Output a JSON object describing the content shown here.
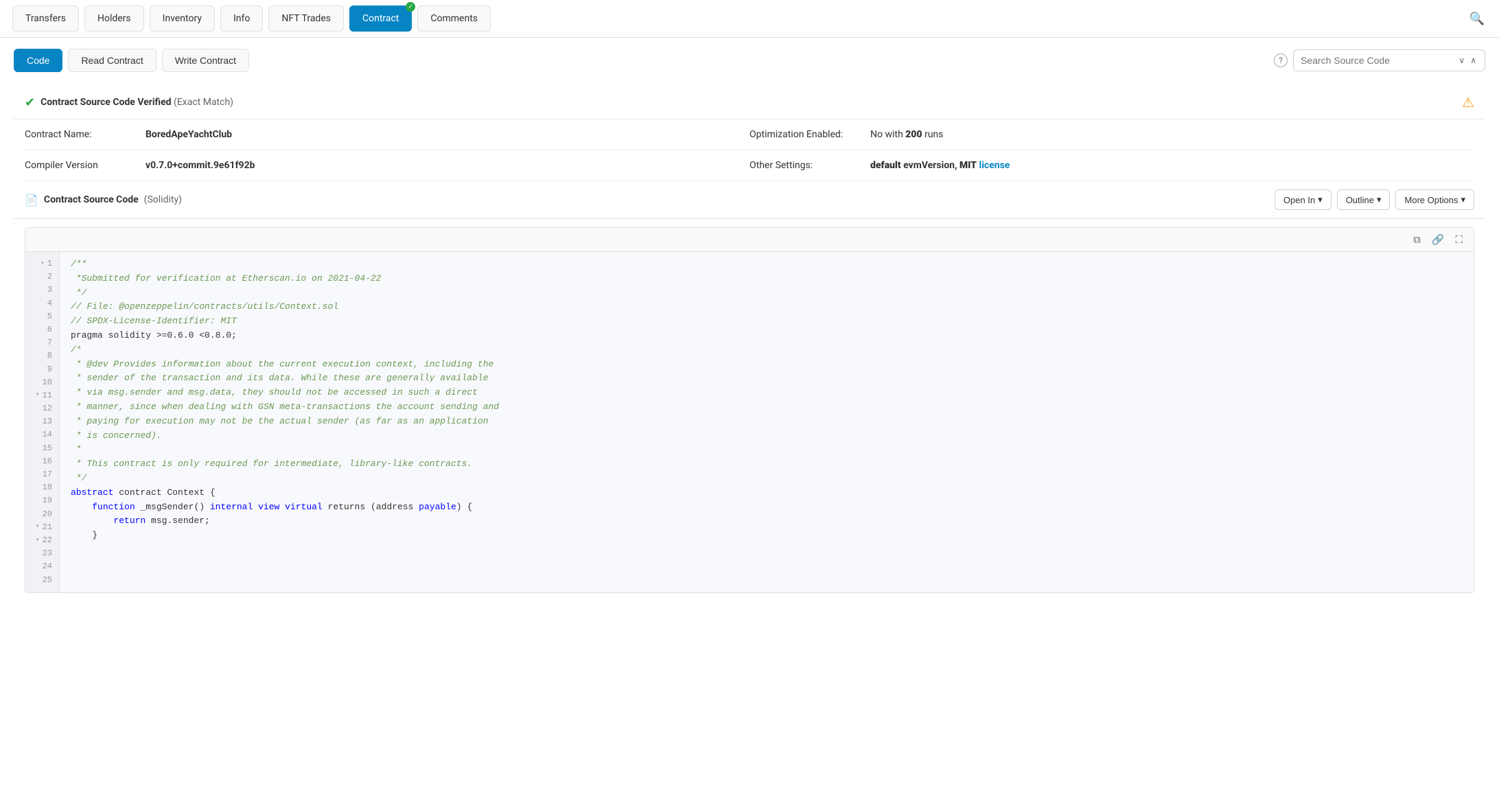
{
  "nav": {
    "tabs": [
      {
        "id": "transfers",
        "label": "Transfers",
        "active": false
      },
      {
        "id": "holders",
        "label": "Holders",
        "active": false
      },
      {
        "id": "inventory",
        "label": "Inventory",
        "active": false
      },
      {
        "id": "info",
        "label": "Info",
        "active": false
      },
      {
        "id": "nft-trades",
        "label": "NFT Trades",
        "active": false
      },
      {
        "id": "contract",
        "label": "Contract",
        "active": true,
        "verified": true
      },
      {
        "id": "comments",
        "label": "Comments",
        "active": false
      }
    ],
    "search_icon": "🔍"
  },
  "sub_tabs": {
    "items": [
      {
        "id": "code",
        "label": "Code",
        "active": true
      },
      {
        "id": "read-contract",
        "label": "Read Contract",
        "active": false
      },
      {
        "id": "write-contract",
        "label": "Write Contract",
        "active": false
      }
    ]
  },
  "search_source": {
    "placeholder": "Search Source Code",
    "help_label": "?",
    "chevron_down": "⌄",
    "chevron_up": "⌃"
  },
  "verified": {
    "check_icon": "✔",
    "title": "Contract Source Code Verified",
    "subtitle": "(Exact Match)",
    "warning_icon": "⚠"
  },
  "contract_info": {
    "name_label": "Contract Name:",
    "name_value": "BoredApeYachtClub",
    "optimization_label": "Optimization Enabled:",
    "optimization_value": "No with ",
    "optimization_runs": "200",
    "optimization_suffix": " runs",
    "compiler_label": "Compiler Version",
    "compiler_value": "v0.7.0+commit.9e61f92b",
    "other_settings_label": "Other Settings:",
    "other_settings_prefix": "default",
    "other_settings_middle": " evmVersion, ",
    "other_settings_license": "MIT",
    "other_settings_license_text": " license",
    "license_url": "#"
  },
  "source_code_section": {
    "doc_icon": "📄",
    "title": "Contract Source Code",
    "subtitle": "(Solidity)",
    "open_in_label": "Open In",
    "outline_label": "Outline",
    "more_options_label": "More Options",
    "copy_icon": "⧉",
    "link_icon": "🔗",
    "fullscreen_icon": "⛶"
  },
  "code": {
    "lines": [
      {
        "num": "1",
        "fold": true,
        "content": "/**",
        "type": "comment"
      },
      {
        "num": "2",
        "fold": false,
        "content": " *Submitted for verification at Etherscan.io on 2021-04-22",
        "type": "comment"
      },
      {
        "num": "3",
        "fold": false,
        "content": " */",
        "type": "comment"
      },
      {
        "num": "4",
        "fold": false,
        "content": "",
        "type": "plain"
      },
      {
        "num": "5",
        "fold": false,
        "content": "// File: @openzeppelin/contracts/utils/Context.sol",
        "type": "comment"
      },
      {
        "num": "6",
        "fold": false,
        "content": "",
        "type": "plain"
      },
      {
        "num": "7",
        "fold": false,
        "content": "// SPDX-License-Identifier: MIT",
        "type": "comment"
      },
      {
        "num": "8",
        "fold": false,
        "content": "",
        "type": "plain"
      },
      {
        "num": "9",
        "fold": false,
        "content": "pragma solidity >=0.6.0 <0.8.0;",
        "type": "pragma"
      },
      {
        "num": "10",
        "fold": false,
        "content": "",
        "type": "plain"
      },
      {
        "num": "11",
        "fold": true,
        "content": "/*",
        "type": "comment"
      },
      {
        "num": "12",
        "fold": false,
        "content": " * @dev Provides information about the current execution context, including the",
        "type": "comment"
      },
      {
        "num": "13",
        "fold": false,
        "content": " * sender of the transaction and its data. While these are generally available",
        "type": "comment"
      },
      {
        "num": "14",
        "fold": false,
        "content": " * via msg.sender and msg.data, they should not be accessed in such a direct",
        "type": "comment"
      },
      {
        "num": "15",
        "fold": false,
        "content": " * manner, since when dealing with GSN meta-transactions the account sending and",
        "type": "comment"
      },
      {
        "num": "16",
        "fold": false,
        "content": " * paying for execution may not be the actual sender (as far as an application",
        "type": "comment"
      },
      {
        "num": "17",
        "fold": false,
        "content": " * is concerned).",
        "type": "comment"
      },
      {
        "num": "18",
        "fold": false,
        "content": " *",
        "type": "comment"
      },
      {
        "num": "19",
        "fold": false,
        "content": " * This contract is only required for intermediate, library-like contracts.",
        "type": "comment"
      },
      {
        "num": "20",
        "fold": false,
        "content": " */",
        "type": "comment"
      },
      {
        "num": "21",
        "fold": true,
        "content": "abstract contract Context {",
        "type": "mixed_abstract"
      },
      {
        "num": "22",
        "fold": true,
        "content": "    function _msgSender() internal view virtual returns (address payable) {",
        "type": "mixed_function"
      },
      {
        "num": "23",
        "fold": false,
        "content": "        return msg.sender;",
        "type": "mixed_return"
      },
      {
        "num": "24",
        "fold": false,
        "content": "    }",
        "type": "plain"
      },
      {
        "num": "25",
        "fold": false,
        "content": "",
        "type": "plain"
      }
    ]
  }
}
